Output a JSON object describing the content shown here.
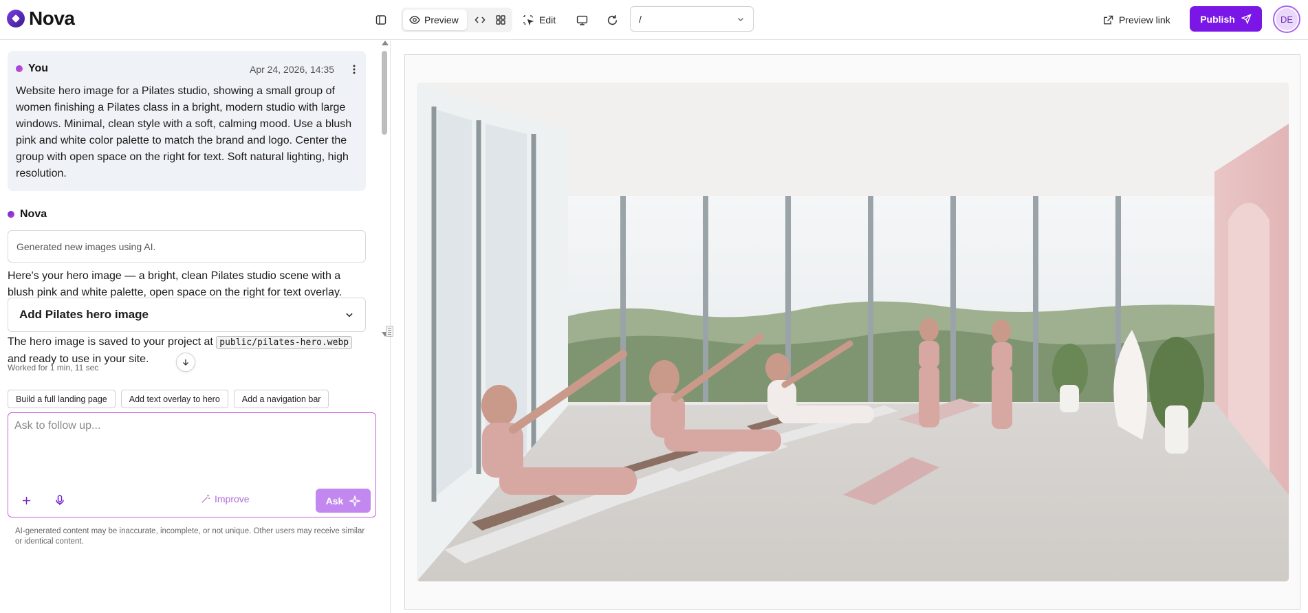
{
  "app": {
    "name": "Nova"
  },
  "toolbar": {
    "preview_label": "Preview",
    "edit_label": "Edit",
    "path_value": "/",
    "preview_link_label": "Preview link",
    "publish_label": "Publish",
    "avatar_initials": "DE"
  },
  "chat": {
    "user_message": {
      "author": "You",
      "timestamp": "Apr 24, 2026, 14:35",
      "text": "Website hero image for a Pilates studio, showing a small group of women finishing a Pilates class in a bright, modern studio with large windows. Minimal, clean style with a soft, calming mood. Use a blush pink and white color palette to match the brand and logo. Center the group with open space on the right for text. Soft natural lighting, high resolution."
    },
    "assistant": {
      "author": "Nova",
      "tool_status": "Generated new images using AI.",
      "reply_1": "Here's your hero image — a bright, clean Pilates studio scene with a blush pink and white palette, open space on the right for text overlay.",
      "accordion_title": "Add Pilates hero image",
      "reply_2_before": "The hero image is saved to your project at ",
      "reply_2_code": "public/pilates-hero.webp",
      "reply_2_after": " and ready to use in your site.",
      "worked_for": "Worked for 1 min, 11 sec"
    },
    "suggestions": [
      "Build a full landing page",
      "Add text overlay to hero",
      "Add a navigation bar"
    ],
    "composer": {
      "placeholder": "Ask to follow up...",
      "improve_label": "Improve",
      "ask_label": "Ask"
    },
    "disclaimer": "AI-generated content may be inaccurate, incomplete, or not unique. Other users may receive similar or identical content."
  },
  "colors": {
    "accent": "#7a17e6",
    "ask_button": "#c388f0",
    "composer_border": "#c65fd8",
    "user_bubble": "#eff2f6"
  },
  "icons": {
    "sidebar_toggle": "sidebar-toggle-icon",
    "preview": "eye-icon",
    "code": "code-icon",
    "grid": "grid-icon",
    "edit": "select-cursor-icon",
    "desktop": "desktop-icon",
    "refresh": "refresh-icon",
    "external": "external-link-icon",
    "send": "send-icon"
  }
}
